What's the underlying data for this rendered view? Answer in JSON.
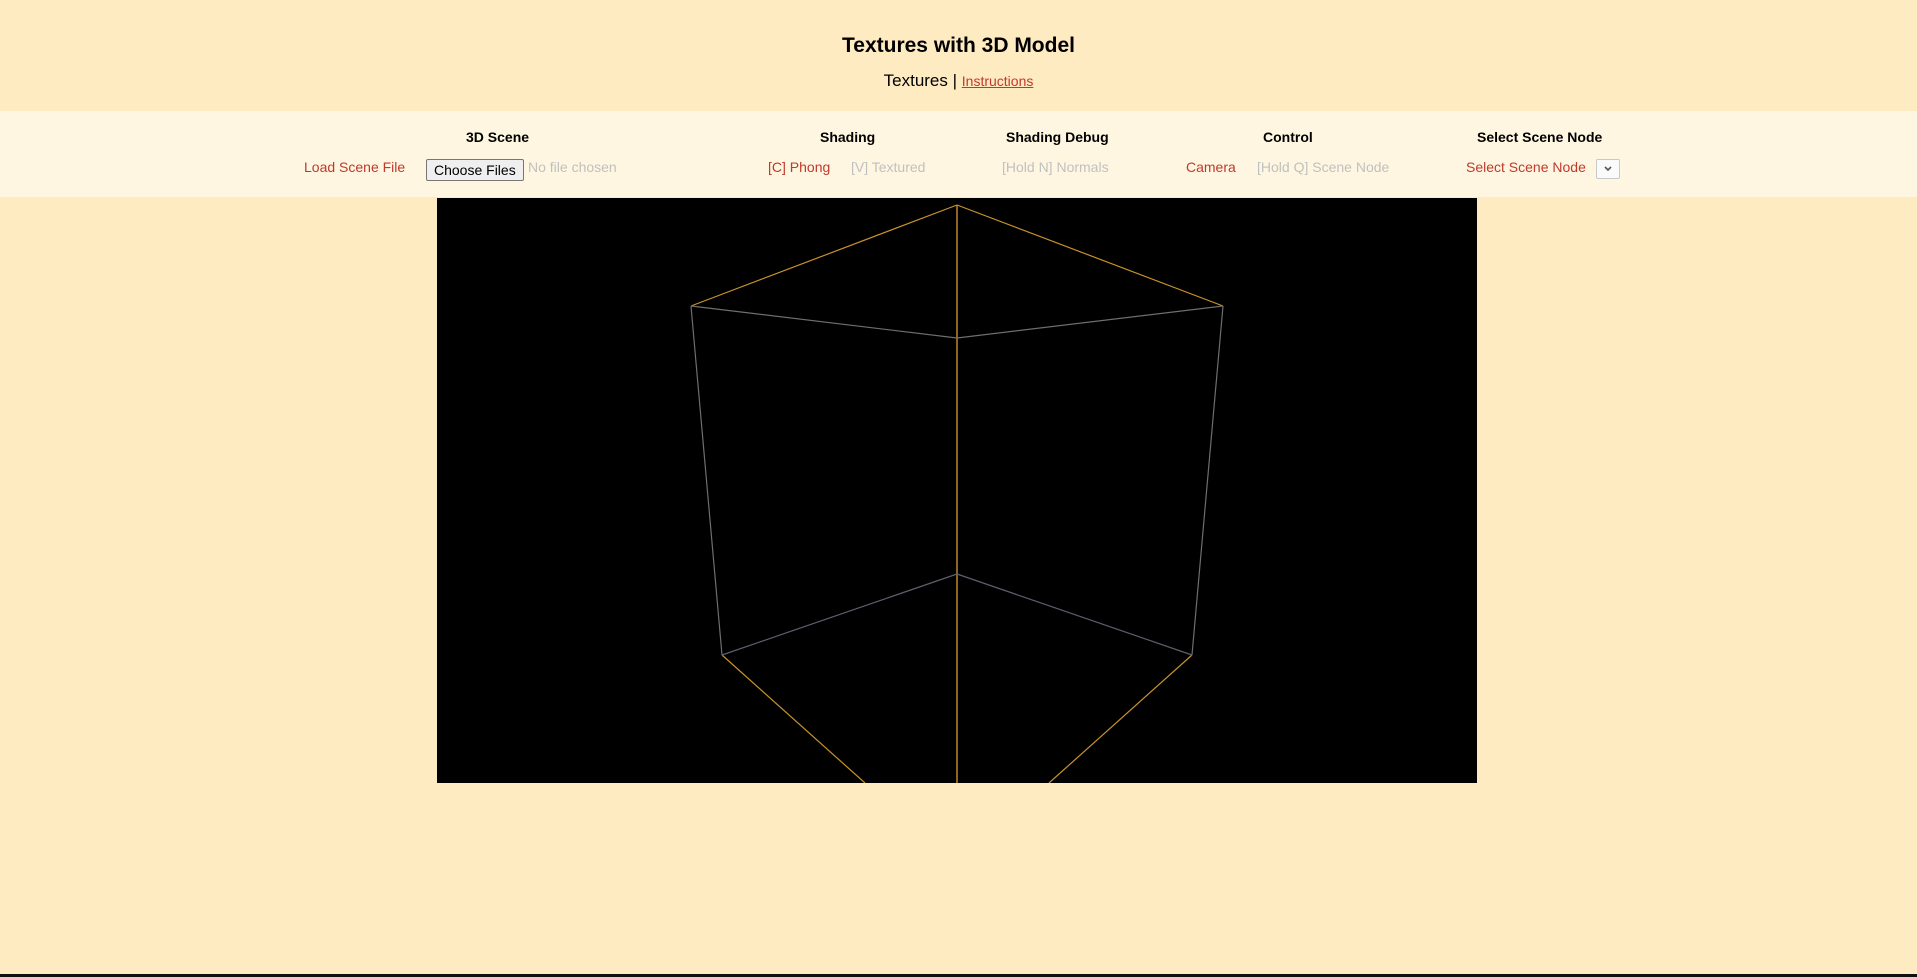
{
  "header": {
    "title": "Textures with 3D Model",
    "current_page": "Textures",
    "separator": " | ",
    "instructions_link": "Instructions"
  },
  "toolbar": {
    "scene": {
      "heading": "3D Scene",
      "load_label": "Load Scene File",
      "choose_files_button": "Choose Files",
      "file_status": "No file chosen"
    },
    "shading": {
      "heading": "Shading",
      "phong": "[C] Phong",
      "textured": "[V] Textured"
    },
    "shading_debug": {
      "heading": "Shading Debug",
      "normals": "[Hold N] Normals"
    },
    "control": {
      "heading": "Control",
      "camera": "Camera",
      "scene_node": "[Hold Q] Scene Node"
    },
    "select_node": {
      "heading": "Select Scene Node",
      "label": "Select Scene Node",
      "selected_value": ""
    }
  },
  "colors": {
    "page_background": "#ffebc2",
    "toolbar_background": "#fff6e1",
    "active_text": "#c0392b",
    "inactive_text": "#c0c0c0",
    "viewport_background": "#000000",
    "wire_highlight": "#c8922a",
    "wire_default": "#6e6e6e"
  },
  "icons": {
    "dropdown": "chevron-down-icon"
  }
}
